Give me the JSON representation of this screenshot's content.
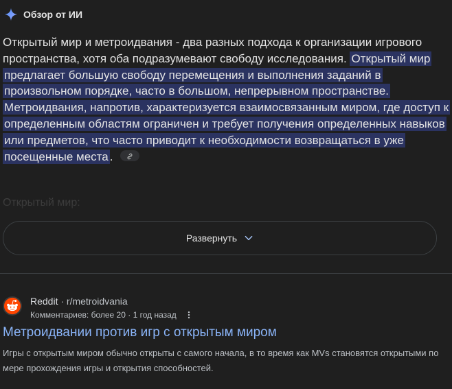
{
  "ai_overview": {
    "title": "Обзор от ИИ",
    "intro": "Открытый мир и метроидвания - два разных подхода к организации игрового пространства, хотя оба подразумевают свободу исследования.",
    "highlight_1": "Открытый мир предлагает большую свободу перемещения и выполнения заданий в произвольном порядке, часто в большом, непрерывном пространстве.",
    "highlight_2": "Метроидвания, напротив, характеризуется взаимосвязанным миром, где доступ к определенным областям ограничен и требует получения определенных навыков или предметов, что часто приводит к необходимости возвращаться в уже посещенные места",
    "trailing": ".",
    "faded_heading": "Открытый мир:",
    "expand_label": "Развернуть"
  },
  "result": {
    "site_name": "Reddit",
    "separator": "·",
    "path": "r/metroidvania",
    "meta": "Комментариев: более 20 · 1 год назад",
    "title": "Метроидвании против игр с открытым миром",
    "snippet": "Игры с открытым миром обычно открыты с самого начала, в то время как MVs становятся открытыми по мере прохождения игры и открытия способностей."
  },
  "colors": {
    "background": "#1f1f1f",
    "highlight": "#2b3361",
    "link": "#8ab4f8",
    "reddit": "#ff4500"
  },
  "icons": [
    "gemini-sparkle-icon",
    "link-icon",
    "chevron-down-icon",
    "reddit-logo-icon",
    "more-vert-icon"
  ]
}
